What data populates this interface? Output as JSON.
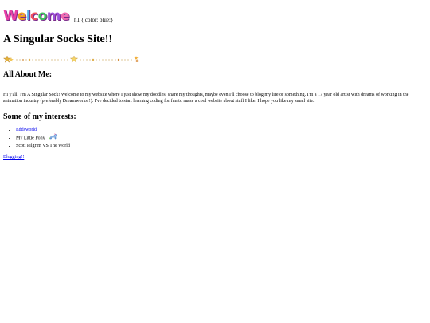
{
  "welcome": {
    "letters": [
      "W",
      "e",
      "l",
      "c",
      "o",
      "m",
      "e"
    ],
    "letter_colors": [
      "#e83fa5",
      "#f0a020",
      "#4fb0e8",
      "#f05060",
      "#3fbf60",
      "#9b4fd8",
      "#f06ab0"
    ]
  },
  "css_leak_text": "h1 { color: blue;}",
  "page_title": "A Singular Socks Site!!",
  "about": {
    "heading": "All About Me:",
    "text": "Hi y'all! I'm A Singular Sock! Welcome to my website where I just show my doodles, share my thoughts, maybe even I'll choose to blog my life or something. I'm a 17 year old artist with dreams of working in the animation industry (preferably Dreamworks!!). I've decided to start learning coding for fun to make a cool website about stuff I like. I hope you like my small site."
  },
  "interests": {
    "heading": "Some of my interests:",
    "items": [
      {
        "label": "Eddsworld",
        "is_link": true
      },
      {
        "label": "My Little Pony",
        "is_link": false,
        "icon": "pony-icon"
      },
      {
        "label": "Scott Pilgrim VS The World",
        "is_link": false
      }
    ]
  },
  "blog_link": "Blogging!!",
  "divider": {
    "icon": "star-divider-icon",
    "colors": [
      "#e4b23a",
      "#c8a050"
    ]
  }
}
